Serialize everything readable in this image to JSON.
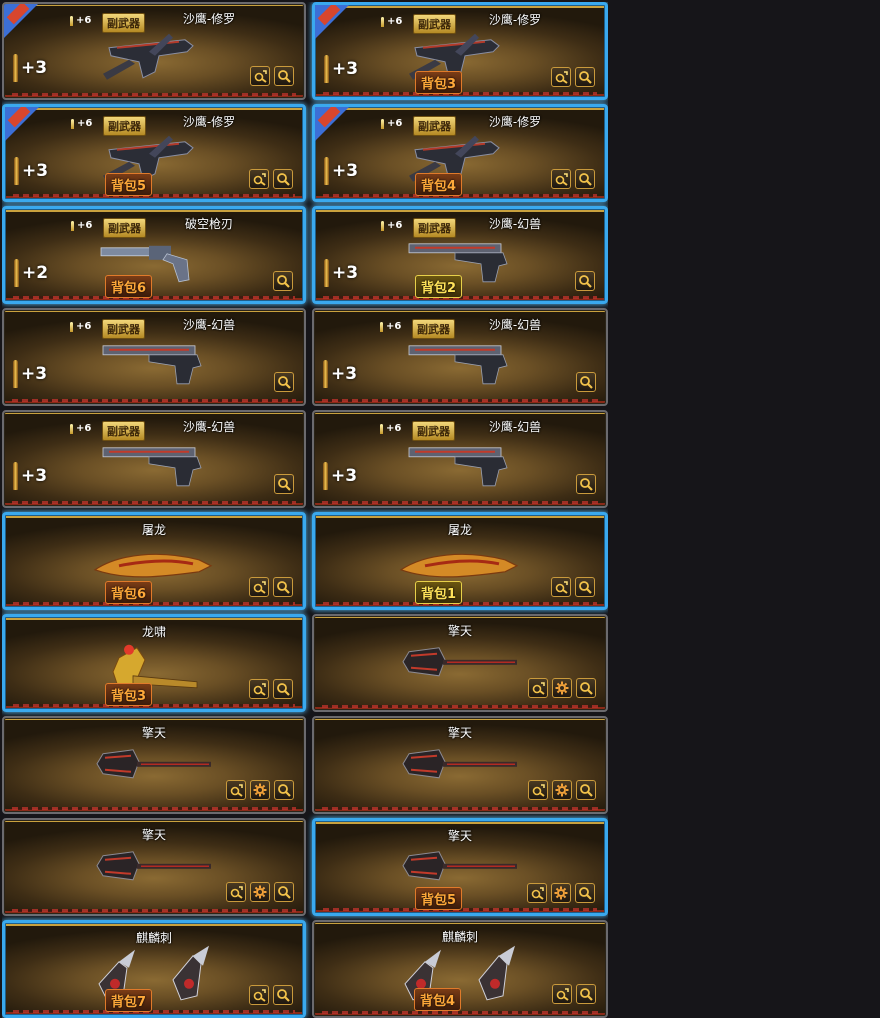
{
  "cards": [
    {
      "name": "沙鹰-修罗",
      "ammo": "+6",
      "tag": "副武器",
      "level": "+3",
      "bag": "",
      "bag_style": "",
      "selected": false,
      "corner": true,
      "weapon": "pistol-dark",
      "buttons": [
        "upgrade",
        "search"
      ]
    },
    {
      "name": "沙鹰-修罗",
      "ammo": "+6",
      "tag": "副武器",
      "level": "+3",
      "bag": "背包3",
      "bag_style": "orange",
      "selected": true,
      "corner": true,
      "weapon": "pistol-dark",
      "buttons": [
        "upgrade",
        "search"
      ]
    },
    {
      "name": "沙鹰-修罗",
      "ammo": "+6",
      "tag": "副武器",
      "level": "+3",
      "bag": "背包5",
      "bag_style": "orange",
      "selected": true,
      "corner": true,
      "weapon": "pistol-dark",
      "buttons": [
        "upgrade",
        "search"
      ]
    },
    {
      "name": "沙鹰-修罗",
      "ammo": "+6",
      "tag": "副武器",
      "level": "+3",
      "bag": "背包4",
      "bag_style": "orange",
      "selected": true,
      "corner": true,
      "weapon": "pistol-dark",
      "buttons": [
        "upgrade",
        "search"
      ]
    },
    {
      "name": "破空枪刃",
      "ammo": "+6",
      "tag": "副武器",
      "level": "+2",
      "bag": "背包6",
      "bag_style": "orange",
      "selected": true,
      "corner": false,
      "weapon": "revolver",
      "buttons": [
        "search"
      ]
    },
    {
      "name": "沙鹰-幻兽",
      "ammo": "+6",
      "tag": "副武器",
      "level": "+3",
      "bag": "背包2",
      "bag_style": "yellow",
      "selected": true,
      "corner": false,
      "weapon": "pistol-long",
      "buttons": [
        "search"
      ]
    },
    {
      "name": "沙鹰-幻兽",
      "ammo": "+6",
      "tag": "副武器",
      "level": "+3",
      "bag": "",
      "bag_style": "",
      "selected": false,
      "corner": false,
      "weapon": "pistol-long",
      "buttons": [
        "search"
      ]
    },
    {
      "name": "沙鹰-幻兽",
      "ammo": "+6",
      "tag": "副武器",
      "level": "+3",
      "bag": "",
      "bag_style": "",
      "selected": false,
      "corner": false,
      "weapon": "pistol-long",
      "buttons": [
        "search"
      ]
    },
    {
      "name": "沙鹰-幻兽",
      "ammo": "+6",
      "tag": "副武器",
      "level": "+3",
      "bag": "",
      "bag_style": "",
      "selected": false,
      "corner": false,
      "weapon": "pistol-long",
      "buttons": [
        "search"
      ]
    },
    {
      "name": "沙鹰-幻兽",
      "ammo": "+6",
      "tag": "副武器",
      "level": "+3",
      "bag": "",
      "bag_style": "",
      "selected": false,
      "corner": false,
      "weapon": "pistol-long",
      "buttons": [
        "search"
      ]
    },
    {
      "name": "屠龙",
      "ammo": "",
      "tag": "",
      "level": "",
      "bag": "背包6",
      "bag_style": "orange",
      "selected": true,
      "corner": false,
      "weapon": "blade",
      "buttons": [
        "upgrade",
        "search"
      ]
    },
    {
      "name": "屠龙",
      "ammo": "",
      "tag": "",
      "level": "",
      "bag": "背包1",
      "bag_style": "yellow",
      "selected": true,
      "corner": false,
      "weapon": "blade",
      "buttons": [
        "upgrade",
        "search"
      ]
    },
    {
      "name": "龙啸",
      "ammo": "",
      "tag": "",
      "level": "",
      "bag": "背包3",
      "bag_style": "orange",
      "selected": true,
      "corner": false,
      "weapon": "axe",
      "buttons": [
        "upgrade",
        "search"
      ]
    },
    {
      "name": "擎天",
      "ammo": "",
      "tag": "",
      "level": "",
      "bag": "",
      "bag_style": "",
      "selected": false,
      "corner": false,
      "weapon": "hammer",
      "buttons": [
        "upgrade",
        "gear",
        "search"
      ]
    },
    {
      "name": "擎天",
      "ammo": "",
      "tag": "",
      "level": "",
      "bag": "",
      "bag_style": "",
      "selected": false,
      "corner": false,
      "weapon": "hammer",
      "buttons": [
        "upgrade",
        "gear",
        "search"
      ]
    },
    {
      "name": "擎天",
      "ammo": "",
      "tag": "",
      "level": "",
      "bag": "",
      "bag_style": "",
      "selected": false,
      "corner": false,
      "weapon": "hammer",
      "buttons": [
        "upgrade",
        "gear",
        "search"
      ]
    },
    {
      "name": "擎天",
      "ammo": "",
      "tag": "",
      "level": "",
      "bag": "",
      "bag_style": "",
      "selected": false,
      "corner": false,
      "weapon": "hammer",
      "buttons": [
        "upgrade",
        "gear",
        "search"
      ]
    },
    {
      "name": "擎天",
      "ammo": "",
      "tag": "",
      "level": "",
      "bag": "背包5",
      "bag_style": "orange",
      "selected": true,
      "corner": false,
      "weapon": "hammer",
      "buttons": [
        "upgrade",
        "gear",
        "search"
      ]
    },
    {
      "name": "麒麟刺",
      "ammo": "",
      "tag": "",
      "level": "",
      "bag": "背包7",
      "bag_style": "orange",
      "selected": true,
      "corner": false,
      "weapon": "claws",
      "buttons": [
        "upgrade",
        "search"
      ]
    },
    {
      "name": "麒麟刺",
      "ammo": "",
      "tag": "",
      "level": "",
      "bag": "背包4",
      "bag_style": "orange",
      "selected": false,
      "corner": false,
      "weapon": "claws",
      "buttons": [
        "upgrade",
        "search"
      ]
    }
  ],
  "colors": {
    "selected_border": "#3aa9ee",
    "card_gold": "#c9a13e",
    "bag_orange": "#ffa93a",
    "bag_yellow": "#ffe35a"
  }
}
